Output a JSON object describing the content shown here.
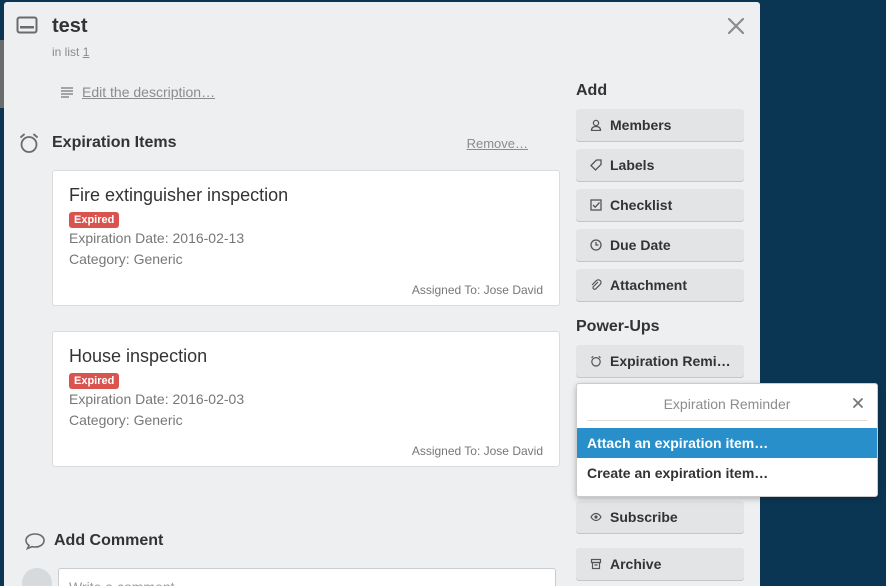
{
  "card": {
    "title": "test",
    "in_list_prefix": "in list",
    "list_name": "1",
    "edit_description": "Edit the description…"
  },
  "expiration": {
    "title": "Expiration Items",
    "remove": "Remove…",
    "items": [
      {
        "name": "Fire extinguisher inspection",
        "status": "Expired",
        "date": "Expiration Date: 2016-02-13",
        "category": "Category: Generic",
        "assigned": "Assigned To: Jose David"
      },
      {
        "name": "House inspection",
        "status": "Expired",
        "date": "Expiration Date: 2016-02-03",
        "category": "Category: Generic",
        "assigned": "Assigned To: Jose David"
      }
    ]
  },
  "comment": {
    "title": "Add Comment",
    "placeholder": "Write a comment…"
  },
  "sidebar": {
    "add_title": "Add",
    "add_buttons": [
      "Members",
      "Labels",
      "Checklist",
      "Due Date",
      "Attachment"
    ],
    "powerups_title": "Power-Ups",
    "powerup_button": "Expiration Remi…",
    "subscribe": "Subscribe",
    "archive": "Archive"
  },
  "popover": {
    "title": "Expiration Reminder",
    "items": [
      "Attach an expiration item…",
      "Create an expiration item…"
    ]
  },
  "colors": {
    "board_bg": "#0b3653",
    "expired_badge": "#d9534f",
    "popover_highlight": "#298fca"
  }
}
